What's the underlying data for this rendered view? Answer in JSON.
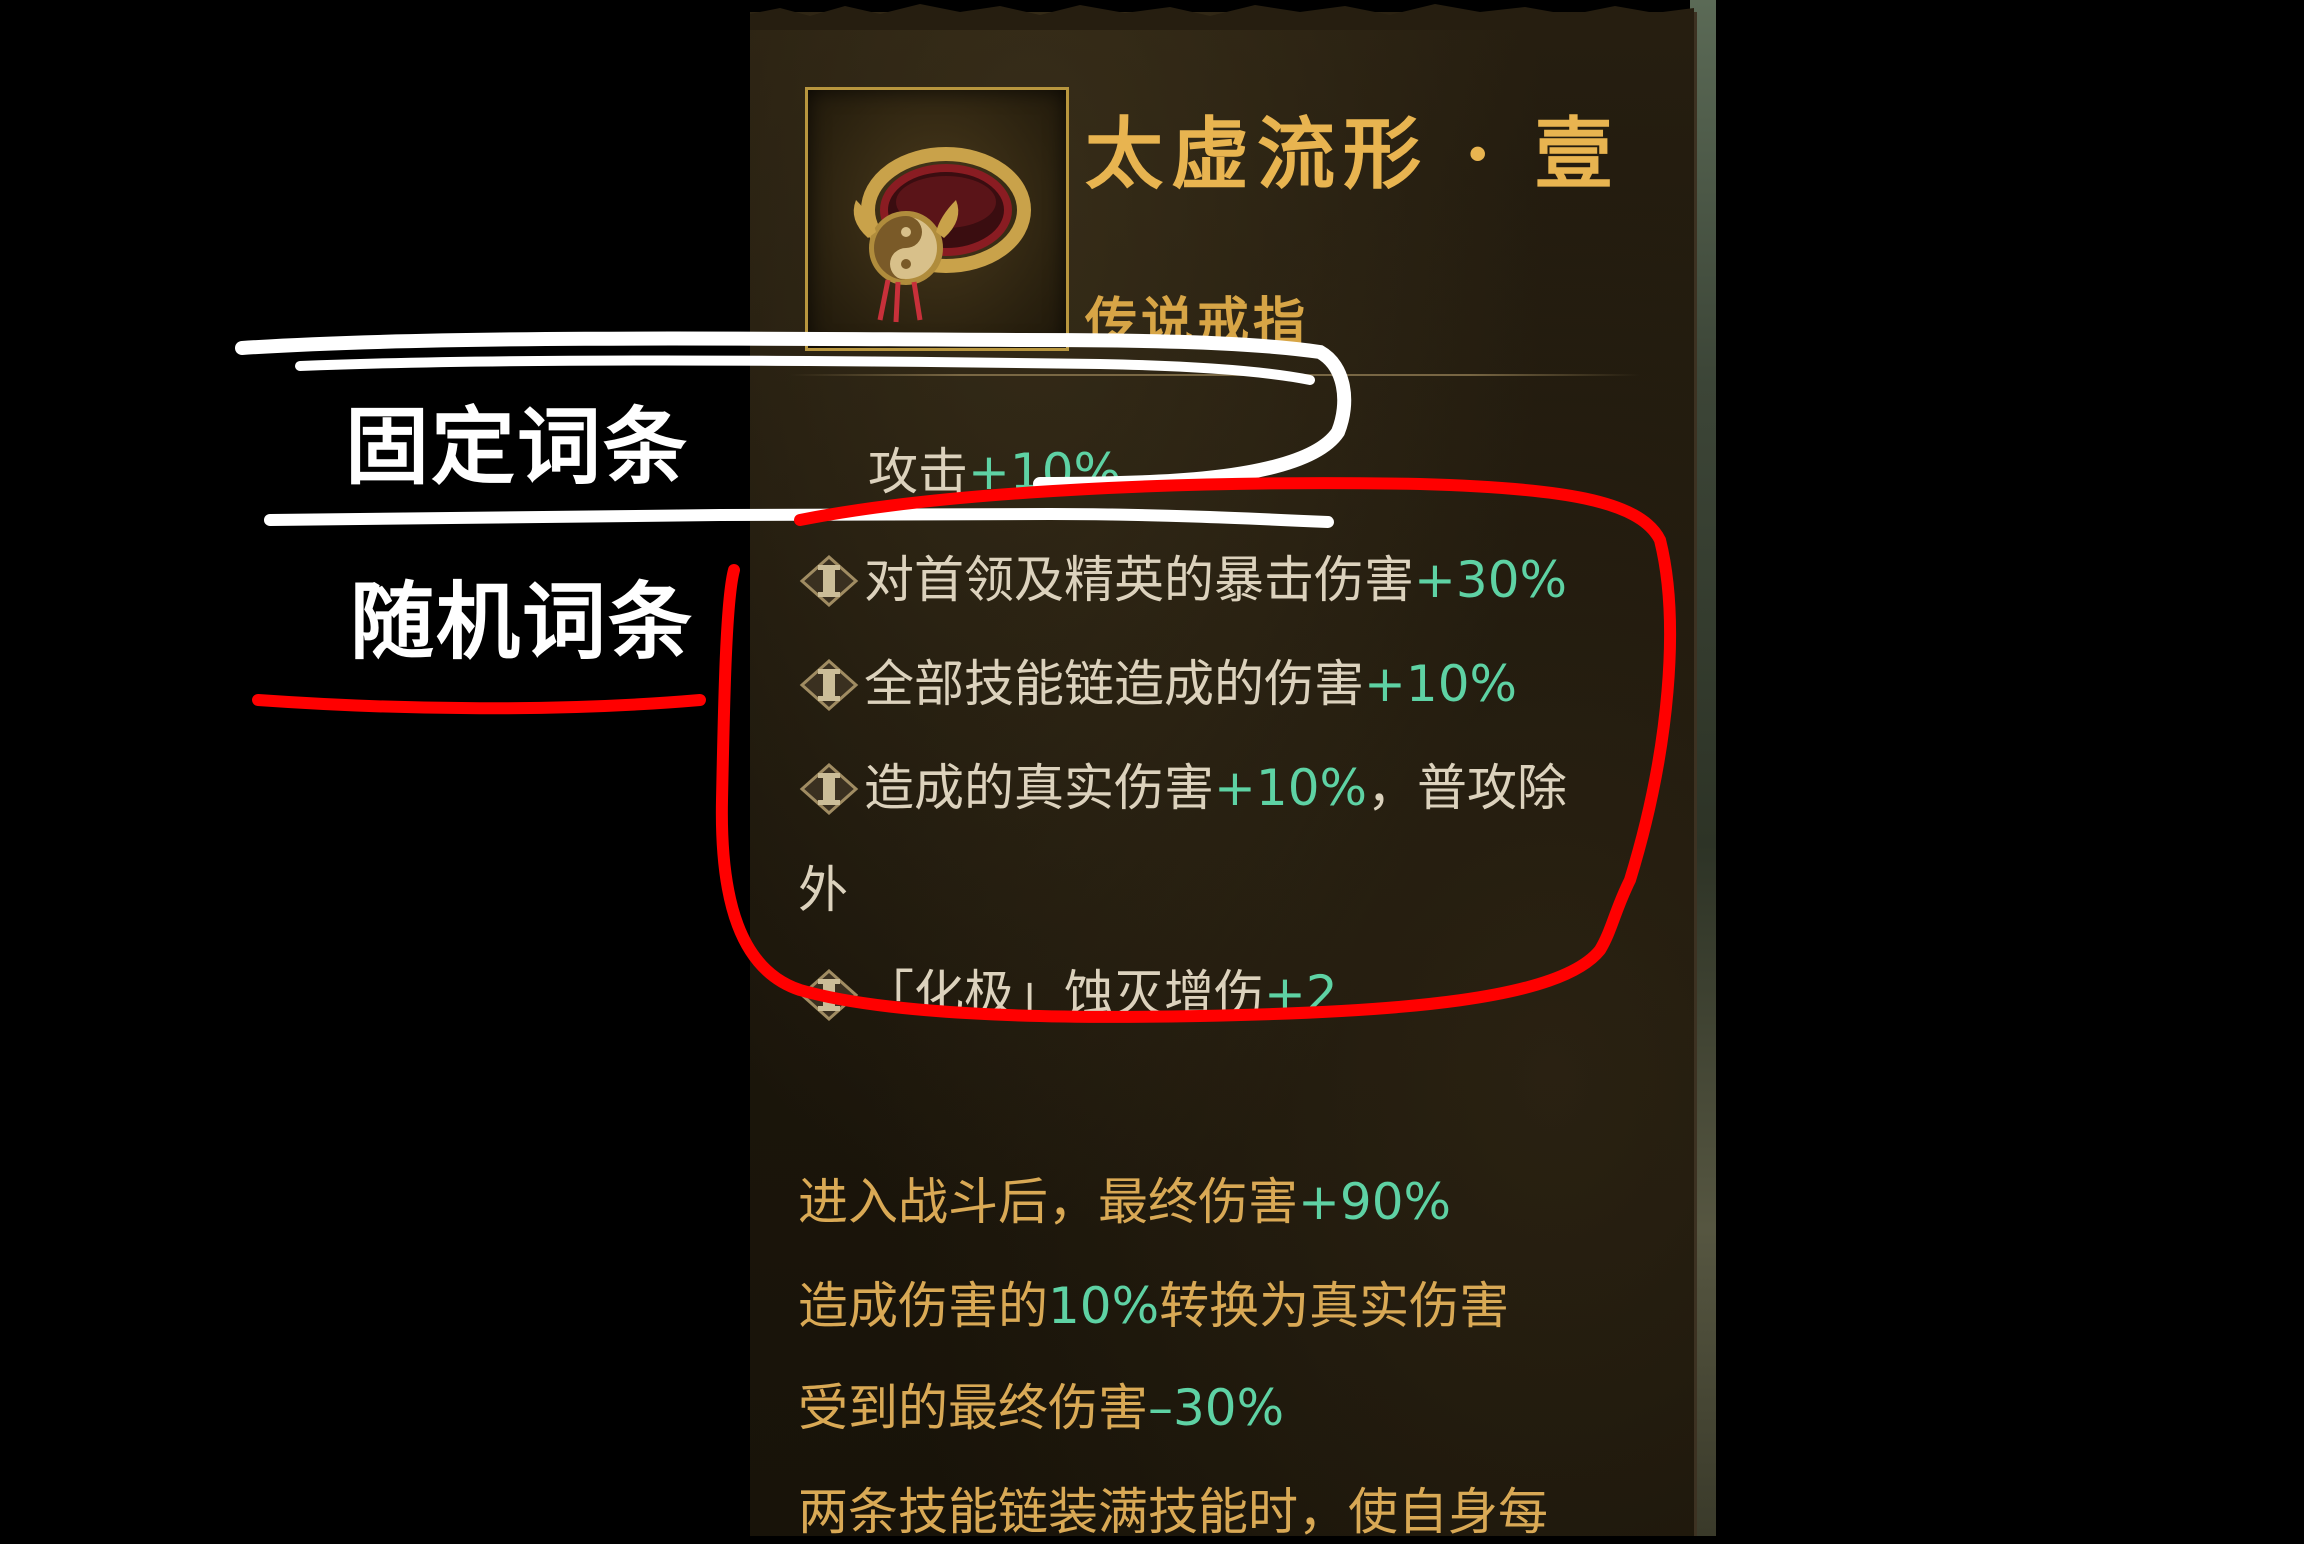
{
  "item": {
    "name": "太虚流形 · 壹",
    "type": "传说戒指",
    "icon": "ring-icon"
  },
  "fixed_affix": {
    "label": "攻击",
    "value": "+10%"
  },
  "random_affixes": [
    {
      "label": "对首领及精英的暴击伤害",
      "value": "+30%",
      "suffix": ""
    },
    {
      "label": "全部技能链造成的伤害",
      "value": "+10%",
      "suffix": ""
    },
    {
      "label": "造成的真实伤害",
      "value": "+10%",
      "suffix": "，普攻除",
      "wrap": "外"
    },
    {
      "label": "「化极」蚀灭增伤",
      "value": "+2",
      "suffix": ""
    }
  ],
  "set_effects": [
    {
      "label": "进入战斗后，最终伤害",
      "value": "+90%",
      "after": ""
    },
    {
      "label": "造成伤害的",
      "value": "10%",
      "after": "转换为真实伤害"
    },
    {
      "label": "受到的最终伤害",
      "value": "–30%",
      "after": ""
    },
    {
      "label": "两条技能链装满技能时，使自身每",
      "value": "",
      "after": ""
    }
  ],
  "annotations": {
    "fixed": "固定词条",
    "random": "随机词条"
  },
  "colors": {
    "title_gold": "#e8b450",
    "bonus_green": "#5ed2a4",
    "effect_gold": "#d9a955",
    "highlight_red": "#ff0000",
    "annotation_white": "#ffffff"
  }
}
